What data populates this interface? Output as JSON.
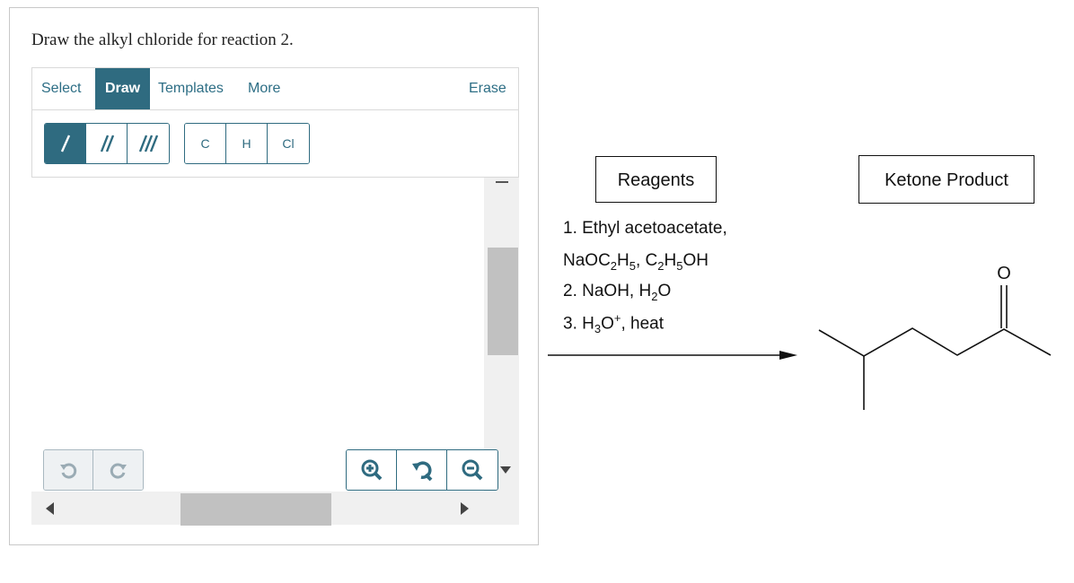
{
  "question": {
    "prompt": "Draw the alkyl chloride for reaction 2."
  },
  "editor": {
    "tabs": [
      {
        "label": "Select",
        "active": false
      },
      {
        "label": "Draw",
        "active": true
      },
      {
        "label": "Templates",
        "active": false
      },
      {
        "label": "More",
        "active": false
      }
    ],
    "erase_label": "Erase",
    "bond_tools": [
      {
        "name": "single-bond",
        "selected": true
      },
      {
        "name": "double-bond",
        "selected": false
      },
      {
        "name": "triple-bond",
        "selected": false
      }
    ],
    "atom_tools": [
      "C",
      "H",
      "Cl"
    ],
    "history_icons": [
      "undo-icon",
      "redo-icon"
    ],
    "zoom_icons": [
      "zoom-in-icon",
      "reset-zoom-icon",
      "zoom-out-icon"
    ]
  },
  "reaction": {
    "reagents_title": "Reagents",
    "product_title": "Ketone Product",
    "steps": [
      {
        "parts": [
          [
            "t",
            "1. Ethyl acetoacetate,"
          ]
        ]
      },
      {
        "parts": [
          [
            "t",
            " NaOC"
          ],
          [
            "sub",
            "2"
          ],
          [
            "t",
            "H"
          ],
          [
            "sub",
            "5"
          ],
          [
            "t",
            ", C"
          ],
          [
            "sub",
            "2"
          ],
          [
            "t",
            "H"
          ],
          [
            "sub",
            "5"
          ],
          [
            "t",
            "OH"
          ]
        ]
      },
      {
        "parts": [
          [
            "t",
            "2. NaOH, H"
          ],
          [
            "sub",
            "2"
          ],
          [
            "t",
            "O"
          ]
        ]
      },
      {
        "parts": [
          [
            "t",
            "3. H"
          ],
          [
            "sub",
            "3"
          ],
          [
            "t",
            "O"
          ],
          [
            "sup",
            "+"
          ],
          [
            "t",
            ", heat"
          ]
        ]
      }
    ],
    "product_atom_label": "O"
  },
  "colors": {
    "accent": "#2f6b80",
    "link": "#2d6e85"
  }
}
